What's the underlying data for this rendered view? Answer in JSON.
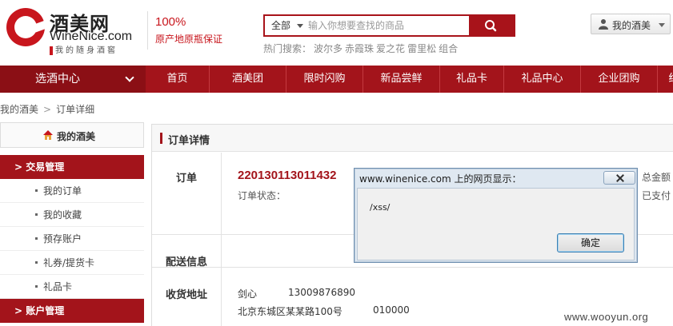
{
  "header": {
    "logo_cn": "酒美网",
    "logo_en": "WineNice.com",
    "logo_slogan": "我的随身酒窖",
    "promo_pct": "100%",
    "promo_text": "原产地原瓶保证",
    "search": {
      "category": "全部",
      "placeholder": "输入你想要查找的商品"
    },
    "hot_label": "热门搜索：",
    "hot_items": [
      "波尔多",
      "赤霞珠",
      "爱之花",
      "雷里松",
      "组合"
    ],
    "my_account": "我的酒美"
  },
  "nav": {
    "category_label": "选酒中心",
    "items": [
      "首页",
      "酒美团",
      "限时闪购",
      "新品尝鲜",
      "礼品卡",
      "礼品中心",
      "企业团购",
      "红"
    ]
  },
  "breadcrumb": {
    "root": "我的酒美",
    "sep": ">",
    "current": "订单详细"
  },
  "sidebar": {
    "title": "我的酒美",
    "section1": "> 交易管理",
    "items": [
      "我的订单",
      "我的收藏",
      "预存账户",
      "礼券/提货卡",
      "礼品卡"
    ],
    "section2": "> 账户管理"
  },
  "main": {
    "title": "订单详情",
    "order_label": "订单",
    "order_number": "220130113011432",
    "order_status_label": "订单状态：",
    "total_label": "总金额",
    "paid_label": "已支付",
    "delivery_label": "配送信息",
    "address_label": "收货地址",
    "recipient_name": "剑心",
    "recipient_phone": "13009876890",
    "address": "北京东城区某某路100号",
    "postcode": "010000"
  },
  "dialog": {
    "title": "www.winenice.com 上的网页显示：",
    "message": "/xss/",
    "ok_label": "确定"
  },
  "watermark": "www.wooyun.org",
  "colors": {
    "brand_red": "#a3141b",
    "logo_red": "#c8161d",
    "dialog_frame": "#dfe8f1"
  }
}
